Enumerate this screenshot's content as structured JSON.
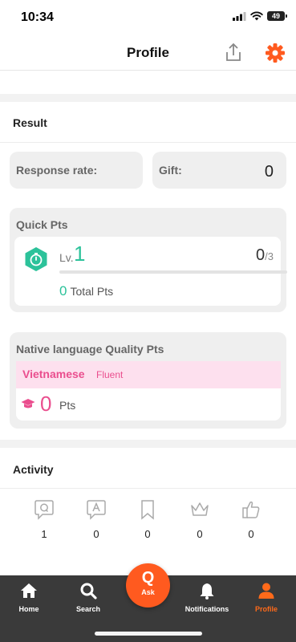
{
  "status_bar": {
    "time": "10:34",
    "battery": "49"
  },
  "header": {
    "title": "Profile",
    "share_icon": "share-icon",
    "settings_icon": "gear-icon"
  },
  "result": {
    "title": "Result",
    "response_rate_label": "Response rate:",
    "gift_label": "Gift:",
    "gift_value": "0"
  },
  "quick_pts": {
    "title": "Quick Pts",
    "level_prefix": "Lv.",
    "level": "1",
    "progress_current": "0",
    "progress_total": "/3",
    "progress_fraction": 0,
    "total_pts_value": "0",
    "total_pts_label": "Total Pts"
  },
  "native_language": {
    "title": "Native language Quality Pts",
    "language": "Vietnamese",
    "level": "Fluent",
    "pts_value": "0",
    "pts_label": "Pts"
  },
  "activity": {
    "title": "Activity",
    "items": [
      {
        "icon": "question-icon",
        "count": "1"
      },
      {
        "icon": "answer-icon",
        "count": "0"
      },
      {
        "icon": "bookmark-icon",
        "count": "0"
      },
      {
        "icon": "crown-icon",
        "count": "0"
      },
      {
        "icon": "thumbs-up-icon",
        "count": "0"
      }
    ]
  },
  "tabbar": {
    "home": "Home",
    "search": "Search",
    "ask": "Ask",
    "notifications": "Notifications",
    "profile": "Profile"
  },
  "colors": {
    "accent": "#ff5a1f",
    "quick_pts_green": "#2cc29a",
    "native_pink": "#ea4e8e"
  }
}
